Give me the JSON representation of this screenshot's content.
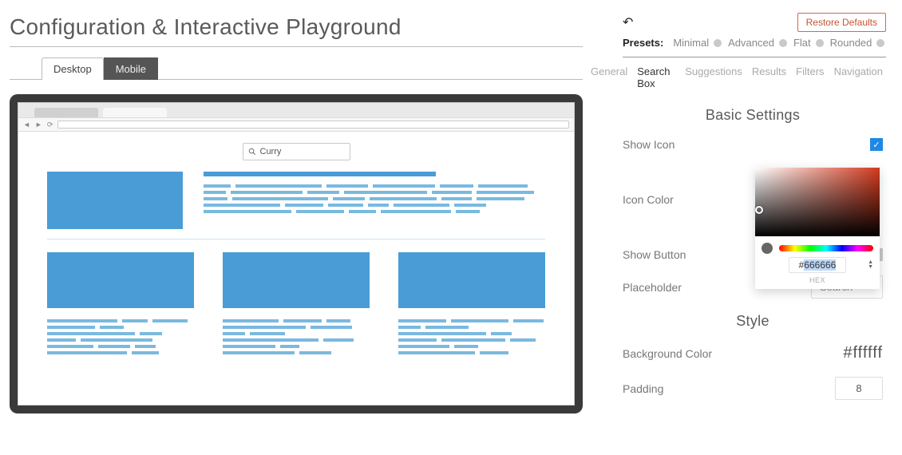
{
  "title": "Configuration & Interactive Playground",
  "tabs": {
    "desktop": "Desktop",
    "mobile": "Mobile"
  },
  "search": {
    "value": "Curry"
  },
  "toolbar": {
    "restore": "Restore Defaults"
  },
  "presets": {
    "label": "Presets:",
    "items": [
      "Minimal",
      "Advanced",
      "Flat",
      "Rounded"
    ]
  },
  "sidetabs": [
    "General",
    "Search Box",
    "Suggestions",
    "Results",
    "Filters",
    "Navigation"
  ],
  "sidetab_active": "Search Box",
  "sections": {
    "basic": {
      "title": "Basic Settings",
      "show_icon": "Show Icon",
      "icon_color": "Icon Color",
      "show_button": "Show Button",
      "placeholder_label": "Placeholder",
      "placeholder_value": "Search"
    },
    "style": {
      "title": "Style",
      "background_color": "Background Color",
      "background_value": "#ffffff",
      "padding_label": "Padding",
      "padding_value": "8"
    }
  },
  "picker": {
    "hex_value": "#666666",
    "hex_label": "HEX"
  }
}
